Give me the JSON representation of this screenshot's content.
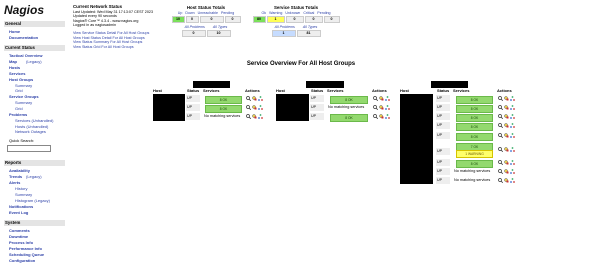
{
  "logo": "Nagios",
  "sidebar": {
    "general": "General",
    "home": "Home",
    "documentation": "Documentation",
    "current_status": "Current Status",
    "tactical": "Tactical Overview",
    "map": "Map",
    "map_legacy": "(Legacy)",
    "hosts": "Hosts",
    "services": "Services",
    "host_groups": "Host Groups",
    "hg_summary": "Summary",
    "hg_grid": "Grid",
    "service_groups": "Service Groups",
    "sg_summary": "Summary",
    "sg_grid": "Grid",
    "problems": "Problems",
    "p_services": "Services (Unhandled)",
    "p_hosts": "Hosts (Unhandled)",
    "p_outages": "Network Outages",
    "quick_search": "Quick Search:",
    "reports": "Reports",
    "availability": "Availability",
    "trends": "Trends",
    "trends_legacy": "(Legacy)",
    "alerts": "Alerts",
    "a_history": "History",
    "a_summary": "Summary",
    "a_histogram": "Histogram (Legacy)",
    "notifications": "Notifications",
    "event_log": "Event Log",
    "system": "System",
    "comments": "Comments",
    "downtime": "Downtime",
    "process_info": "Process Info",
    "performance_info": "Performance Info",
    "scheduling_queue": "Scheduling Queue",
    "configuration": "Configuration"
  },
  "info": {
    "title": "Current Network Status",
    "updated": "Last Updated: Wed May 31 17:13:07 CEST 2023",
    "interval": "Updated every 90 seconds",
    "version": "Nagios® Core™ 4.3.4 - www.nagios.org",
    "logged": "Logged in as nagiosadmin",
    "links": [
      "View Service Status Detail For All Host Groups",
      "View Host Status Detail For All Host Groups",
      "View Status Summary For All Host Groups",
      "View Status Grid For All Host Groups"
    ]
  },
  "host_totals": {
    "title": "Host Status Totals",
    "headers": [
      "Up",
      "Down",
      "Unreachable",
      "Pending"
    ],
    "values": [
      "10",
      "0",
      "0",
      "0"
    ],
    "sub_headers": [
      "All Problems",
      "All Types"
    ],
    "sub_values": [
      "0",
      "10"
    ]
  },
  "service_totals": {
    "title": "Service Status Totals",
    "headers": [
      "Ok",
      "Warning",
      "Unknown",
      "Critical",
      "Pending"
    ],
    "values": [
      "80",
      "1",
      "0",
      "0",
      "0"
    ],
    "sub_headers": [
      "All Problems",
      "All Types"
    ],
    "sub_values": [
      "1",
      "81"
    ]
  },
  "overview_title": "Service Overview For All Host Groups",
  "col_headers": {
    "host": "Host",
    "status": "Status",
    "services": "Services",
    "actions": "Actions"
  },
  "status_up": "UP",
  "ok_label": "8 OK",
  "ok_label_7": "7 OK",
  "warning_label": "1 WARNING",
  "no_match": "No matching services",
  "colors": {
    "ok": "#93d96e",
    "warning": "#ffff6b",
    "link": "#2b3fa7",
    "header_bg": "#e4e4e4"
  }
}
